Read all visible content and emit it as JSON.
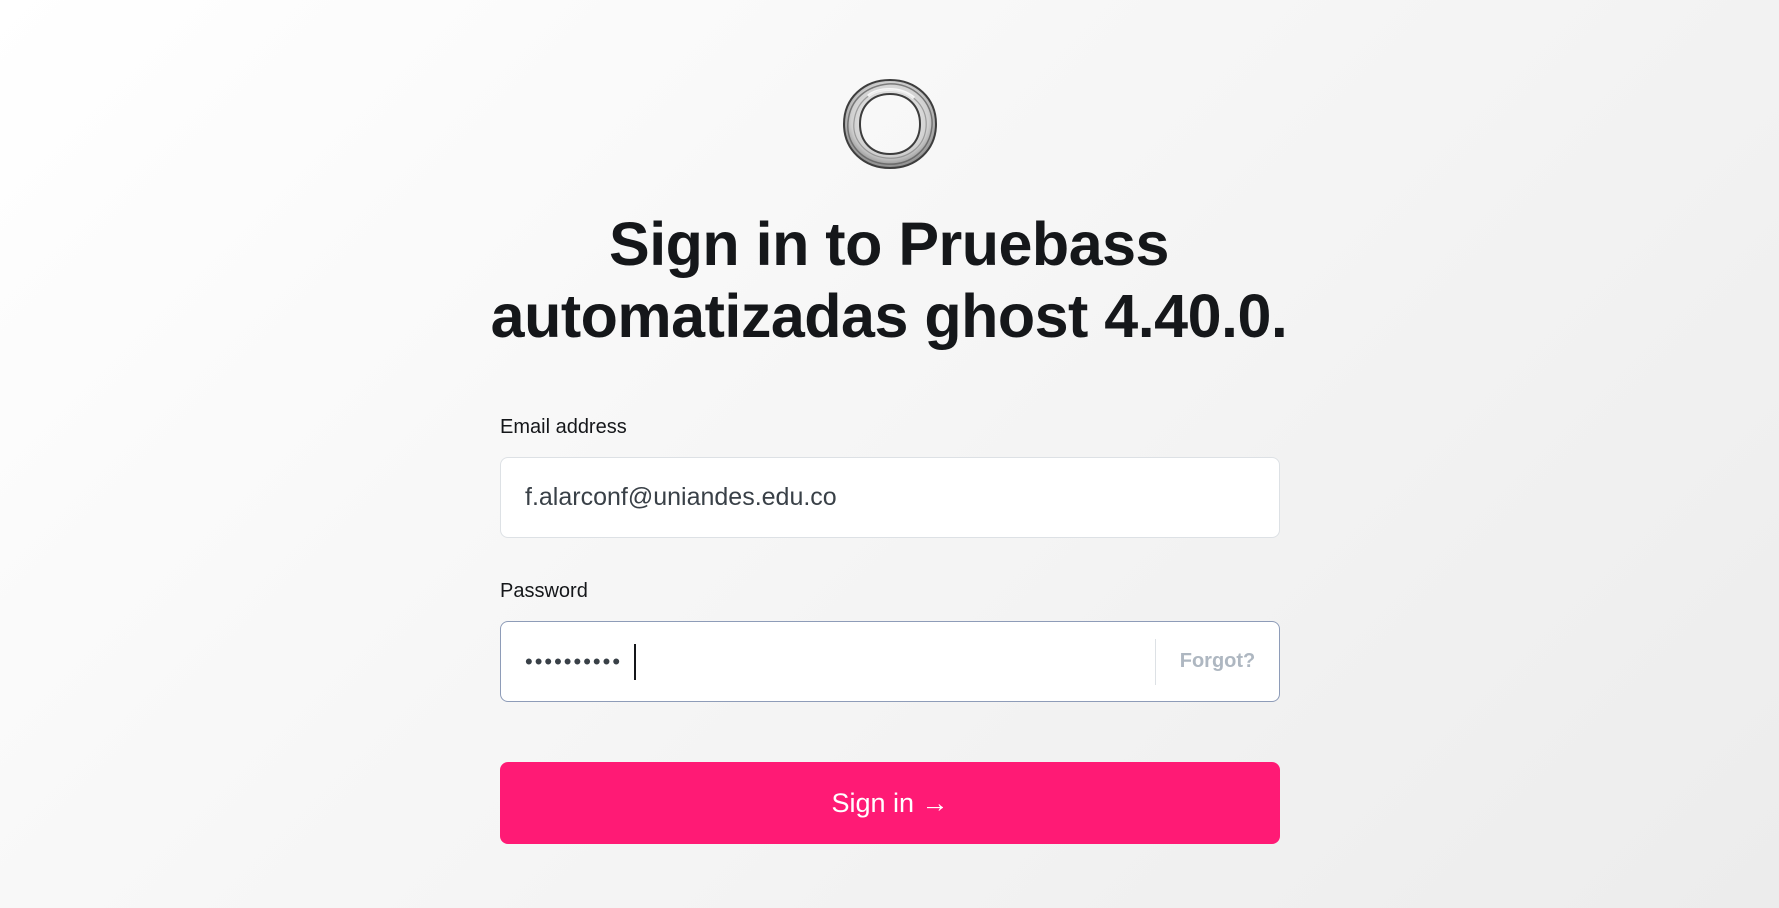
{
  "logo": {
    "icon": "ring-logo-icon"
  },
  "heading": {
    "line1": "Sign in to Pruebass",
    "line2": "automatizadas ghost 4.40.0."
  },
  "form": {
    "email": {
      "label": "Email address",
      "value": "f.alarconf@uniandes.edu.co"
    },
    "password": {
      "label": "Password",
      "value": "••••••••••",
      "forgot_label": "Forgot?"
    },
    "submit_label": "Sign in →"
  },
  "colors": {
    "accent": "#ff1a75",
    "text": "#15171a",
    "muted": "#aeb7c1"
  }
}
